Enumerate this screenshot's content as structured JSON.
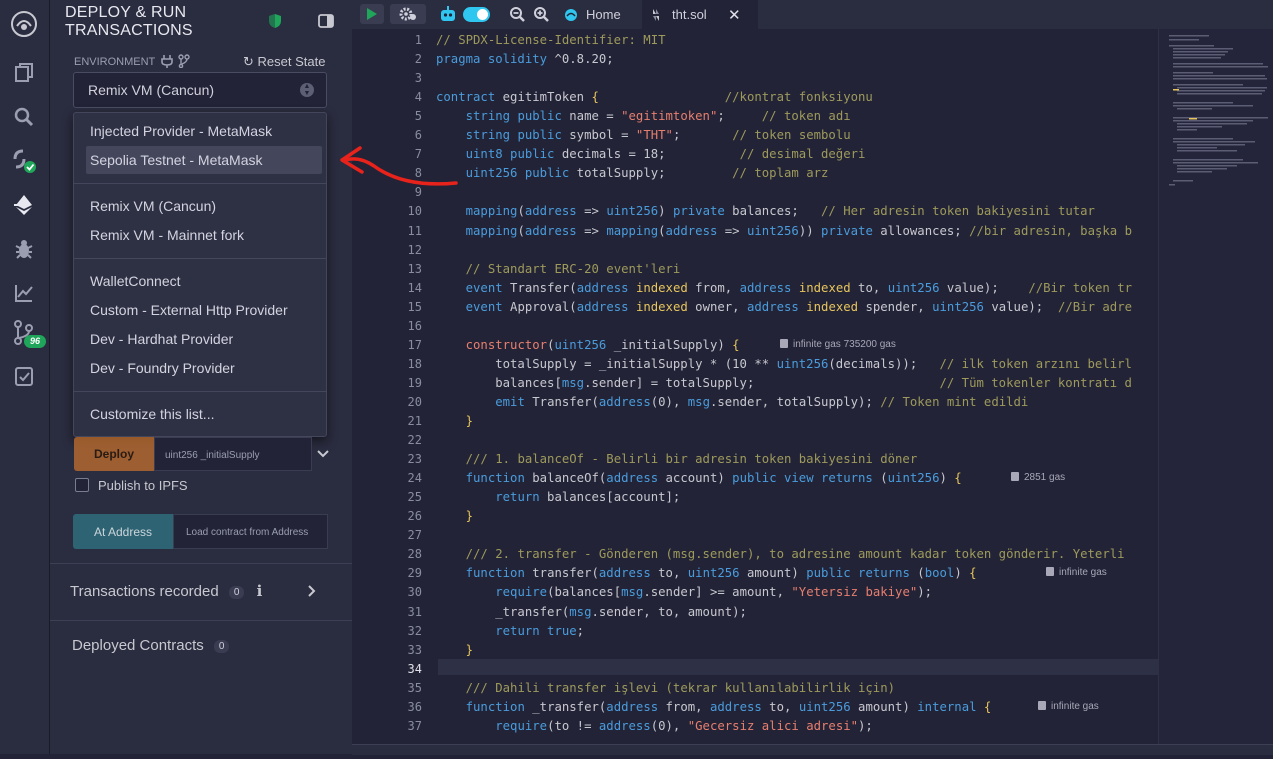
{
  "panel": {
    "title_line1": "DEPLOY & RUN",
    "title_line2": "TRANSACTIONS",
    "environment_label": "ENVIRONMENT",
    "reset_state_label": "Reset State",
    "selected_environment": "Remix VM (Cancun)",
    "dropdown_groups": [
      [
        "Injected Provider - MetaMask",
        "Sepolia Testnet - MetaMask"
      ],
      [
        "Remix VM (Cancun)",
        "Remix VM - Mainnet fork"
      ],
      [
        "WalletConnect",
        "Custom - External Http Provider",
        "Dev - Hardhat Provider",
        "Dev - Foundry Provider"
      ],
      [
        "Customize this list..."
      ]
    ],
    "highlighted_item": "Sepolia Testnet - MetaMask",
    "deploy_label": "Deploy",
    "deploy_input_placeholder": "uint256 _initialSupply",
    "publish_ipfs_label": "Publish to IPFS",
    "at_address_label": "At Address",
    "load_contract_placeholder": "Load contract from Address",
    "transactions_recorded_label": "Transactions recorded",
    "transactions_recorded_count": "0",
    "deployed_contracts_label": "Deployed Contracts",
    "deployed_contracts_count": "0"
  },
  "sidebar": {
    "git_badge": "96",
    "icons": [
      "remix-logo-icon",
      "file-explorer-icon",
      "search-icon",
      "solidity-compiler-icon",
      "deploy-run-icon",
      "debugger-icon",
      "analysis-icon",
      "git-icon",
      "verify-icon"
    ]
  },
  "tabs": {
    "home_label": "Home",
    "file_label": "tht.sol"
  },
  "editor": {
    "lines": [
      {
        "n": "1",
        "html": "<span class='c-com'>// SPDX-License-Identifier: MIT</span>"
      },
      {
        "n": "2",
        "html": "<span class='c-kw'>pragma solidity</span> ^0.8.20;"
      },
      {
        "n": "3",
        "html": ""
      },
      {
        "n": "4",
        "html": "<span class='c-kw'>contract</span> egitimToken <span class='c-brk'>{</span>                 <span class='c-com'>//kontrat fonksiyonu</span>"
      },
      {
        "n": "5",
        "html": "    <span class='c-kw'>string public</span> name = <span class='c-str'>\"egitimtoken\"</span>;     <span class='c-com'>// token adı</span>"
      },
      {
        "n": "6",
        "html": "    <span class='c-kw'>string public</span> symbol = <span class='c-str'>\"THT\"</span>;       <span class='c-com'>// token sembolu</span>"
      },
      {
        "n": "7",
        "html": "    <span class='c-kw'>uint8 public</span> decimals = 18;          <span class='c-com'>// desimal değeri</span>"
      },
      {
        "n": "8",
        "html": "    <span class='c-kw'>uint256 public</span> totalSupply;         <span class='c-com'>// toplam arz</span>"
      },
      {
        "n": "9",
        "html": ""
      },
      {
        "n": "10",
        "html": "    <span class='c-kw'>mapping</span>(<span class='c-kw'>address</span> => <span class='c-kw'>uint256</span>) <span class='c-kw'>private</span> balances;   <span class='c-com'>// Her adresin token bakiyesini tutar</span>"
      },
      {
        "n": "11",
        "html": "    <span class='c-kw'>mapping</span>(<span class='c-kw'>address</span> => <span class='c-kw'>mapping</span>(<span class='c-kw'>address</span> => <span class='c-kw'>uint256</span>)) <span class='c-kw'>private</span> allowances; <span class='c-com'>//bir adresin, başka b</span>"
      },
      {
        "n": "12",
        "html": ""
      },
      {
        "n": "13",
        "html": "    <span class='c-com'>// Standart ERC-20 event'leri</span>"
      },
      {
        "n": "14",
        "html": "    <span class='c-kw'>event</span> Transfer(<span class='c-kw'>address</span> <span class='c-ann'>indexed</span> from, <span class='c-kw'>address</span> <span class='c-ann'>indexed</span> to, <span class='c-kw'>uint256</span> value);    <span class='c-com'>//Bir token tr</span>"
      },
      {
        "n": "15",
        "html": "    <span class='c-kw'>event</span> Approval(<span class='c-kw'>address</span> <span class='c-ann'>indexed</span> owner, <span class='c-kw'>address</span> <span class='c-ann'>indexed</span> spender, <span class='c-kw'>uint256</span> value);  <span class='c-com'>//Bir adre</span>"
      },
      {
        "n": "16",
        "html": ""
      },
      {
        "n": "17",
        "html": "    <span class='c-str'>constructor</span>(<span class='c-kw'>uint256</span> _initialSupply) <span class='c-brk'>{</span>"
      },
      {
        "n": "18",
        "html": "        totalSupply = _initialSupply * (10 ** <span class='c-kw'>uint256</span>(decimals));   <span class='c-com'>// ilk token arzını belirl</span>"
      },
      {
        "n": "19",
        "html": "        balances[<span class='c-kw'>msg</span>.sender] = totalSupply;                         <span class='c-com'>// Tüm tokenler kontratı d</span>"
      },
      {
        "n": "20",
        "html": "        <span class='c-kw'>emit</span> Transfer(<span class='c-kw'>address</span>(0), <span class='c-kw'>msg</span>.sender, totalSupply); <span class='c-com'>// Token mint edildi</span>"
      },
      {
        "n": "21",
        "html": "    <span class='c-brk'>}</span>"
      },
      {
        "n": "22",
        "html": ""
      },
      {
        "n": "23",
        "html": "    <span class='c-com'>/// 1. balanceOf - Belirli bir adresin token bakiyesini döner</span>"
      },
      {
        "n": "24",
        "html": "    <span class='c-kw'>function</span> balanceOf(<span class='c-kw'>address</span> account) <span class='c-kw'>public view returns</span> (<span class='c-kw'>uint256</span>) <span class='c-brk'>{</span>"
      },
      {
        "n": "25",
        "html": "        <span class='c-kw'>return</span> balances[account];"
      },
      {
        "n": "26",
        "html": "    <span class='c-brk'>}</span>"
      },
      {
        "n": "27",
        "html": ""
      },
      {
        "n": "28",
        "html": "    <span class='c-com'>/// 2. transfer - Gönderen (msg.sender), to adresine amount kadar token gönderir. Yeterli</span>"
      },
      {
        "n": "29",
        "html": "    <span class='c-kw'>function</span> transfer(<span class='c-kw'>address</span> to, <span class='c-kw'>uint256</span> amount) <span class='c-kw'>public returns</span> (<span class='c-kw'>bool</span>) <span class='c-brk'>{</span>"
      },
      {
        "n": "30",
        "html": "        <span class='c-kw'>require</span>(balances[<span class='c-kw'>msg</span>.sender] >= amount, <span class='c-str'>\"Yetersiz bakiye\"</span>);"
      },
      {
        "n": "31",
        "html": "        _transfer(<span class='c-kw'>msg</span>.sender, to, amount);"
      },
      {
        "n": "32",
        "html": "        <span class='c-kw'>return true</span>;"
      },
      {
        "n": "33",
        "html": "    <span class='c-brk'>}</span>"
      },
      {
        "n": "34",
        "html": ""
      },
      {
        "n": "35",
        "html": "    <span class='c-com'>/// Dahili transfer işlevi (tekrar kullanılabilirlik için)</span>"
      },
      {
        "n": "36",
        "html": "    <span class='c-kw'>function</span> _transfer(<span class='c-kw'>address</span> from, <span class='c-kw'>address</span> to, <span class='c-kw'>uint256</span> amount) <span class='c-kw'>internal</span> <span class='c-brk'>{</span>"
      },
      {
        "n": "37",
        "html": "        <span class='c-kw'>require</span>(to != <span class='c-kw'>address</span>(0), <span class='c-str'>\"Gecersiz alici adresi\"</span>);"
      }
    ],
    "gas_hints": [
      {
        "line": "17",
        "text": "infinite gas 735200 gas"
      },
      {
        "line": "24",
        "text": "2851 gas"
      },
      {
        "line": "29",
        "text": "infinite gas"
      },
      {
        "line": "36",
        "text": "infinite gas"
      }
    ],
    "current_line": "34"
  },
  "annotation_color": "#e8231c",
  "accent_color": "#2fc7f0"
}
